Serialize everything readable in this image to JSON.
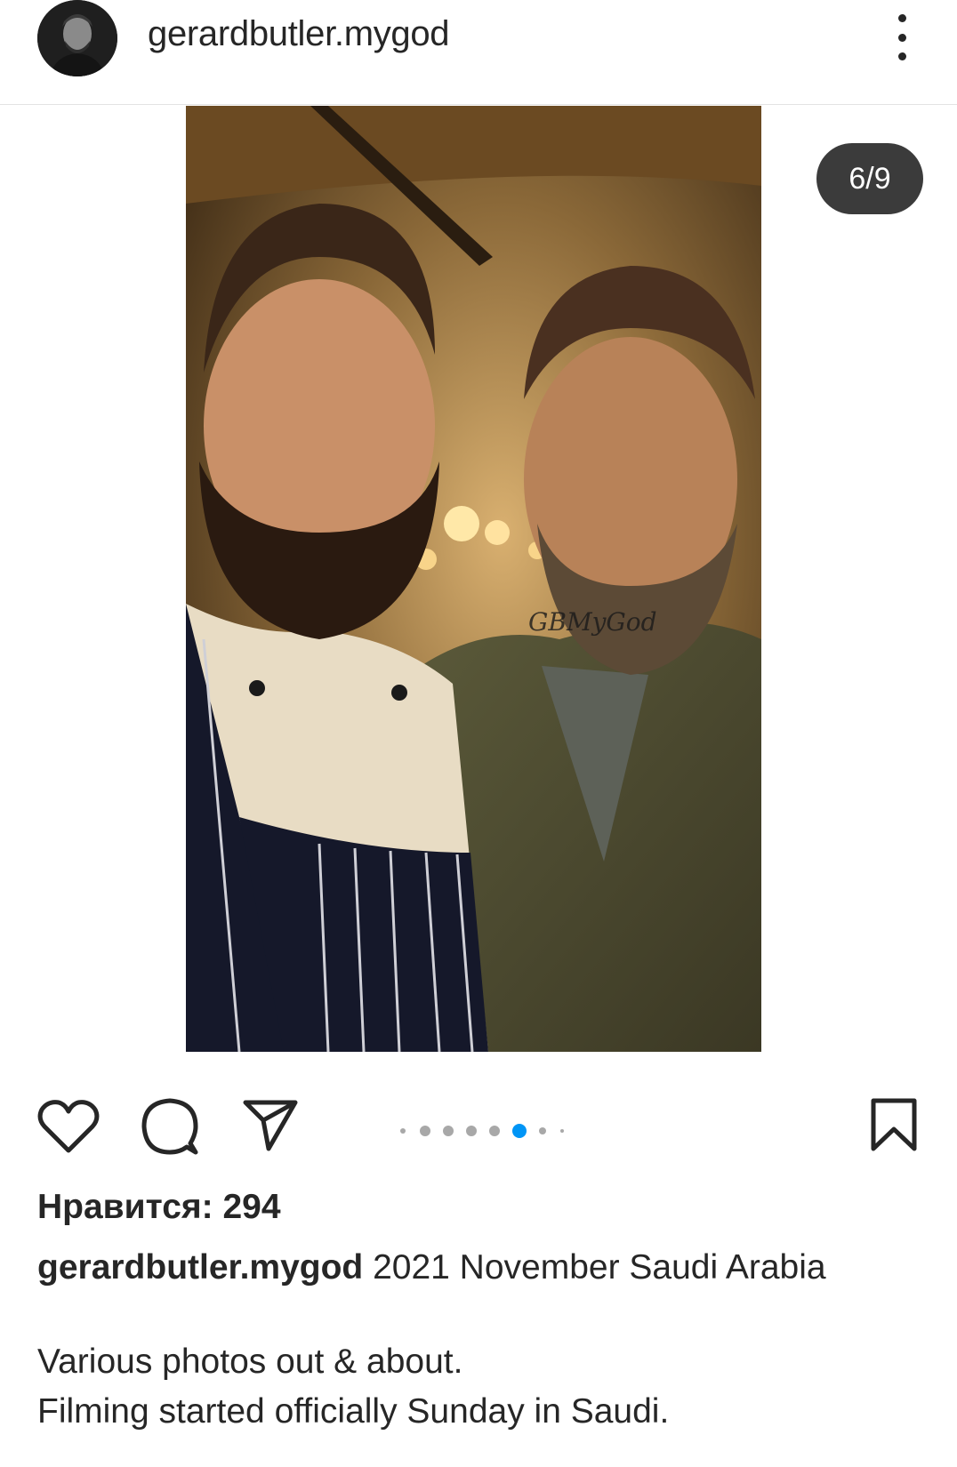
{
  "post": {
    "username": "gerardbutler.mygod",
    "image_counter": "6/9",
    "watermark": "GBMyGod",
    "carousel": {
      "total_dots": 8,
      "active_index": 5
    }
  },
  "actions": {
    "like_icon": "heart-icon",
    "comment_icon": "comment-icon",
    "share_icon": "send-icon",
    "save_icon": "bookmark-icon"
  },
  "likes_text": "Нравится: 294",
  "caption": {
    "username": "gerardbutler.mygod",
    "text": "2021 November Saudi Arabia",
    "line1": "Various photos out & about.",
    "line2": "Filming started officially Sunday in Saudi."
  },
  "colors": {
    "text": "#262626",
    "active_dot": "#0095f6",
    "inactive_dot": "#a8a8a8",
    "counter_bg": "#3b3b3b"
  }
}
